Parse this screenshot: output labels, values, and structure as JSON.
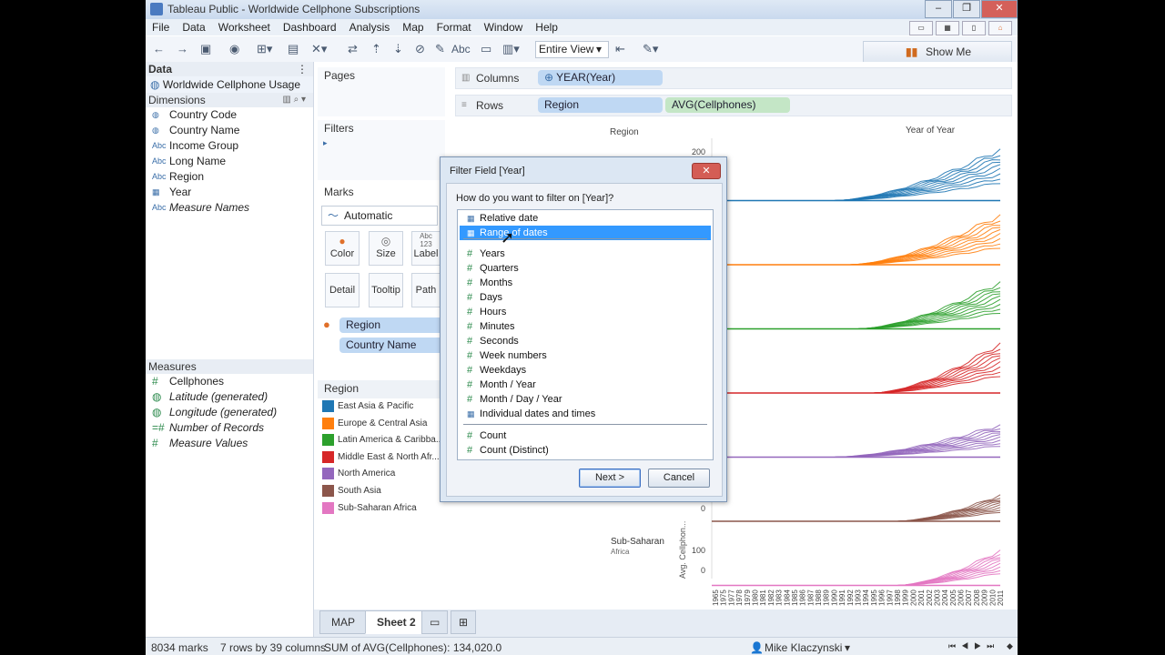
{
  "window": {
    "title": "Tableau Public - Worldwide Cellphone Subscriptions"
  },
  "menu": [
    "File",
    "Data",
    "Worksheet",
    "Dashboard",
    "Analysis",
    "Map",
    "Format",
    "Window",
    "Help"
  ],
  "toolbar": {
    "view_mode": "Entire View",
    "show_me": "Show Me",
    "abc_label": "Abc"
  },
  "data_pane": {
    "header": "Data",
    "datasource": "Worldwide Cellphone Usage (...",
    "dimensions_header": "Dimensions",
    "dimensions": [
      {
        "icon": "globe",
        "label": "Country Code"
      },
      {
        "icon": "globe",
        "label": "Country Name"
      },
      {
        "icon": "Abc",
        "label": "Income Group"
      },
      {
        "icon": "Abc",
        "label": "Long Name"
      },
      {
        "icon": "Abc",
        "label": "Region"
      },
      {
        "icon": "calendar",
        "label": "Year"
      },
      {
        "icon": "Abc",
        "label": "Measure Names"
      }
    ],
    "measures_header": "Measures",
    "measures": [
      {
        "icon": "#",
        "label": "Cellphones"
      },
      {
        "icon": "globe",
        "label": "Latitude (generated)"
      },
      {
        "icon": "globe",
        "label": "Longitude (generated)"
      },
      {
        "icon": "=#",
        "label": "Number of Records"
      },
      {
        "icon": "#",
        "label": "Measure Values"
      }
    ]
  },
  "shelves": {
    "pages": "Pages",
    "filters": "Filters",
    "marks": "Marks",
    "mark_type": "Automatic",
    "mark_buttons": [
      "Color",
      "Size",
      "Label",
      "Detail",
      "Tooltip",
      "Path"
    ],
    "size_glyph": "Abc",
    "size_sub": "123",
    "mark_fields": [
      "Region",
      "Country Name"
    ],
    "columns_label": "Columns",
    "columns_pill": "YEAR(Year)",
    "rows_label": "Rows",
    "rows_pills": [
      "Region",
      "AVG(Cellphones)"
    ]
  },
  "legend": {
    "title": "Region",
    "items": [
      {
        "label": "East Asia & Pacific",
        "color": "#1f77b4"
      },
      {
        "label": "Europe & Central Asia",
        "color": "#ff7f0e"
      },
      {
        "label": "Latin America & Caribba...",
        "color": "#2ca02c"
      },
      {
        "label": "Middle East & North Afr...",
        "color": "#d62728"
      },
      {
        "label": "North America",
        "color": "#9467bd"
      },
      {
        "label": "South Asia",
        "color": "#8c564b"
      },
      {
        "label": "Sub-Saharan Africa",
        "color": "#e377c2"
      }
    ]
  },
  "chart_data": {
    "type": "line",
    "title": "Year of Year",
    "row_header": "Region",
    "ylabel": "Avg. Cellphon...",
    "visible_row_labels": [
      {
        "region": "Sub-Saharan Africa",
        "lines": [
          "Sub-Saharan",
          "Africa"
        ]
      }
    ],
    "y_ticks_visible": [
      "200",
      "0",
      "100",
      "0"
    ],
    "x": [
      "1965",
      "1975",
      "1977",
      "1978",
      "1979",
      "1980",
      "1981",
      "1982",
      "1983",
      "1984",
      "1985",
      "1986",
      "1987",
      "1988",
      "1989",
      "1990",
      "1991",
      "1992",
      "1993",
      "1994",
      "1995",
      "1996",
      "1997",
      "1998",
      "1999",
      "2000",
      "2001",
      "2002",
      "2003",
      "2004",
      "2005",
      "2006",
      "2007",
      "2008",
      "2009",
      "2010",
      "2011"
    ],
    "series": [
      {
        "name": "East Asia & Pacific",
        "color": "#1f77b4",
        "start_year": 1990,
        "peak": 175
      },
      {
        "name": "Europe & Central Asia",
        "color": "#ff7f0e",
        "start_year": 1992,
        "peak": 170
      },
      {
        "name": "Latin America & Caribba...",
        "color": "#2ca02c",
        "start_year": 1993,
        "peak": 160
      },
      {
        "name": "Middle East & North Afr...",
        "color": "#d62728",
        "start_year": 1995,
        "peak": 170
      },
      {
        "name": "North America",
        "color": "#9467bd",
        "start_year": 1990,
        "peak": 110
      },
      {
        "name": "South Asia",
        "color": "#8c564b",
        "start_year": 1998,
        "peak": 90
      },
      {
        "name": "Sub-Saharan Africa",
        "color": "#e377c2",
        "start_year": 1998,
        "peak": 120
      }
    ]
  },
  "tabs": {
    "map": "MAP",
    "sheet": "Sheet 2"
  },
  "status": {
    "marks": "8034 marks",
    "dims": "7 rows by 39 columns",
    "sum": "SUM of AVG(Cellphones): 134,020.0",
    "user": "Mike Klaczynski"
  },
  "dialog": {
    "title": "Filter Field [Year]",
    "question": "How do you want to filter on [Year]?",
    "options": [
      {
        "icon": "calendar",
        "label": "Relative date"
      },
      {
        "icon": "calendar",
        "label": "Range of dates",
        "selected": true
      },
      {
        "icon": "#",
        "label": "Years"
      },
      {
        "icon": "#",
        "label": "Quarters"
      },
      {
        "icon": "#",
        "label": "Months"
      },
      {
        "icon": "#",
        "label": "Days"
      },
      {
        "icon": "#",
        "label": "Hours"
      },
      {
        "icon": "#",
        "label": "Minutes"
      },
      {
        "icon": "#",
        "label": "Seconds"
      },
      {
        "icon": "#",
        "label": "Week numbers"
      },
      {
        "icon": "#",
        "label": "Weekdays"
      },
      {
        "icon": "#",
        "label": "Month / Year"
      },
      {
        "icon": "#",
        "label": "Month / Day / Year"
      },
      {
        "icon": "calendar",
        "label": "Individual dates and times"
      },
      {
        "icon": "#",
        "label": "Count"
      },
      {
        "icon": "#",
        "label": "Count (Distinct)"
      }
    ],
    "next": "Next >",
    "cancel": "Cancel"
  }
}
